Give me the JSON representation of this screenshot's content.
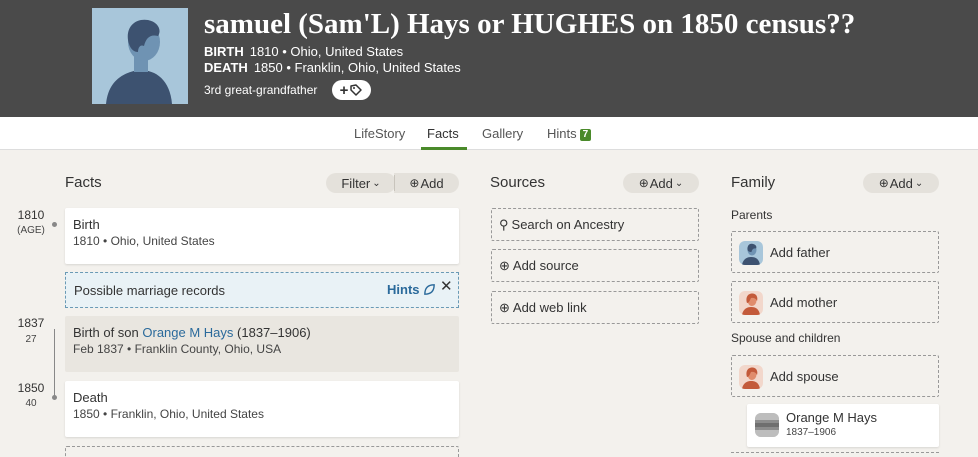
{
  "person": {
    "name": "samuel (Sam'L) Hays or HUGHES on 1850 census??",
    "birth_label": "BIRTH",
    "birth_value": "1810 • Ohio, United States",
    "death_label": "DEATH",
    "death_value": "1850 • Franklin, Ohio, United States",
    "relationship": "3rd great-grandfather",
    "tag_button": "+"
  },
  "tabs": [
    {
      "label": "LifeStory"
    },
    {
      "label": "Facts",
      "active": true
    },
    {
      "label": "Gallery"
    },
    {
      "label": "Hints",
      "badge": "7"
    }
  ],
  "facts": {
    "title": "Facts",
    "filter_label": "Filter",
    "add_label": "Add",
    "timeline": [
      {
        "year": "1810",
        "age": "(AGE)"
      },
      {
        "year": "1837",
        "age": "27"
      },
      {
        "year": "1850",
        "age": "40"
      }
    ],
    "items": [
      {
        "title": "Birth",
        "detail": "1810 • Ohio, United States"
      },
      {
        "title_prefix": "Birth of son ",
        "title_link": "Orange M Hays",
        "title_suffix": " (1837–1906)",
        "detail": "Feb 1837 • Franklin County, Ohio, USA"
      },
      {
        "title": "Death",
        "detail": "1850 • Franklin, Ohio, United States"
      }
    ],
    "hint": {
      "text": "Possible marriage records",
      "link": "Hints",
      "close": "✕"
    }
  },
  "sources": {
    "title": "Sources",
    "add_label": "Add",
    "buttons": [
      {
        "label": "Search on Ancestry",
        "icon": "search-icon"
      },
      {
        "label": "Add source",
        "icon": "plus-circle-icon"
      },
      {
        "label": "Add web link",
        "icon": "plus-circle-icon"
      }
    ]
  },
  "family": {
    "title": "Family",
    "add_label": "Add",
    "parents_label": "Parents",
    "add_father": "Add father",
    "add_mother": "Add mother",
    "spouse_label": "Spouse and children",
    "add_spouse": "Add spouse",
    "child": {
      "name": "Orange M Hays",
      "dates": "1837–1906"
    }
  },
  "colors": {
    "header_bg": "#4a4a4a",
    "accent_green": "#4a8a2a",
    "link_blue": "#2b6a9b",
    "hint_bg": "#e9f2f6",
    "page_bg": "#f3f1ed"
  }
}
